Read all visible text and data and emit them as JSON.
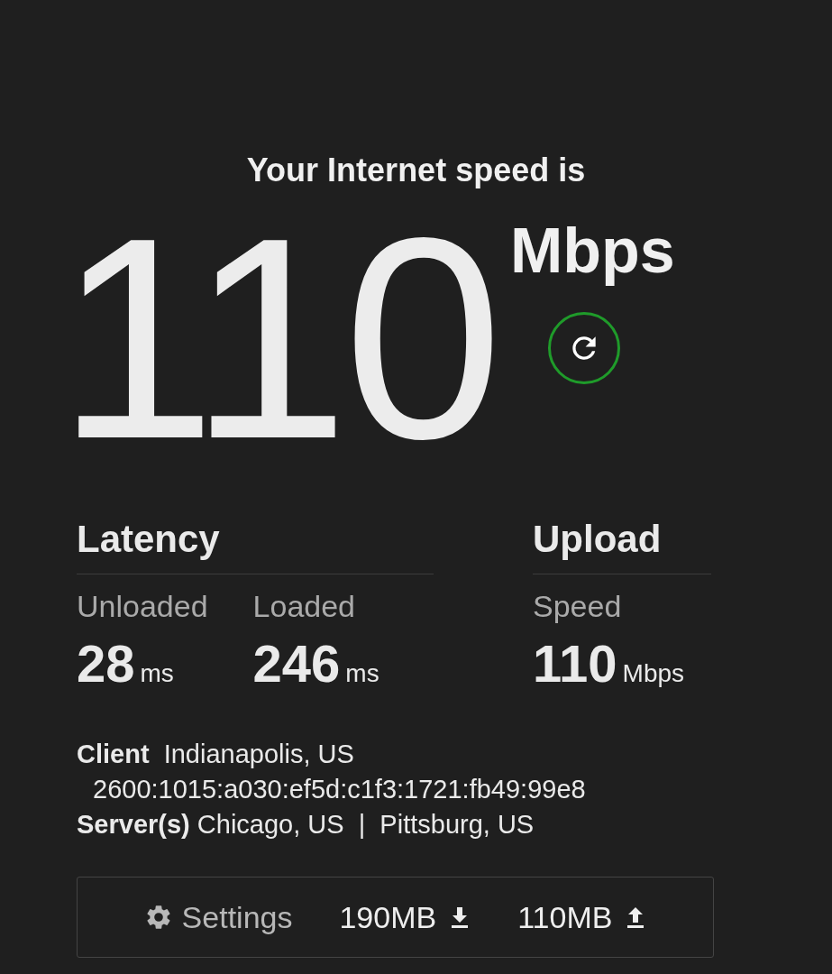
{
  "headline": "Your Internet speed is",
  "speed": {
    "value": "110",
    "unit": "Mbps"
  },
  "groups": [
    {
      "title": "Latency",
      "metrics": [
        {
          "label": "Unloaded",
          "value": "28",
          "unit": "ms"
        },
        {
          "label": "Loaded",
          "value": "246",
          "unit": "ms"
        }
      ]
    },
    {
      "title": "Upload",
      "metrics": [
        {
          "label": "Speed",
          "value": "110",
          "unit": "Mbps"
        }
      ]
    }
  ],
  "info": [
    "**Client**  Indianapolis, US",
    "2600:1015:a030:ef5d:c1f3:1721:fb49:99e8",
    "**Server(s)** Chicago, US  |  Pittsburg, US"
  ],
  "footer": {
    "settings": "Settings",
    "download": "190MB",
    "upload": "110MB"
  }
}
